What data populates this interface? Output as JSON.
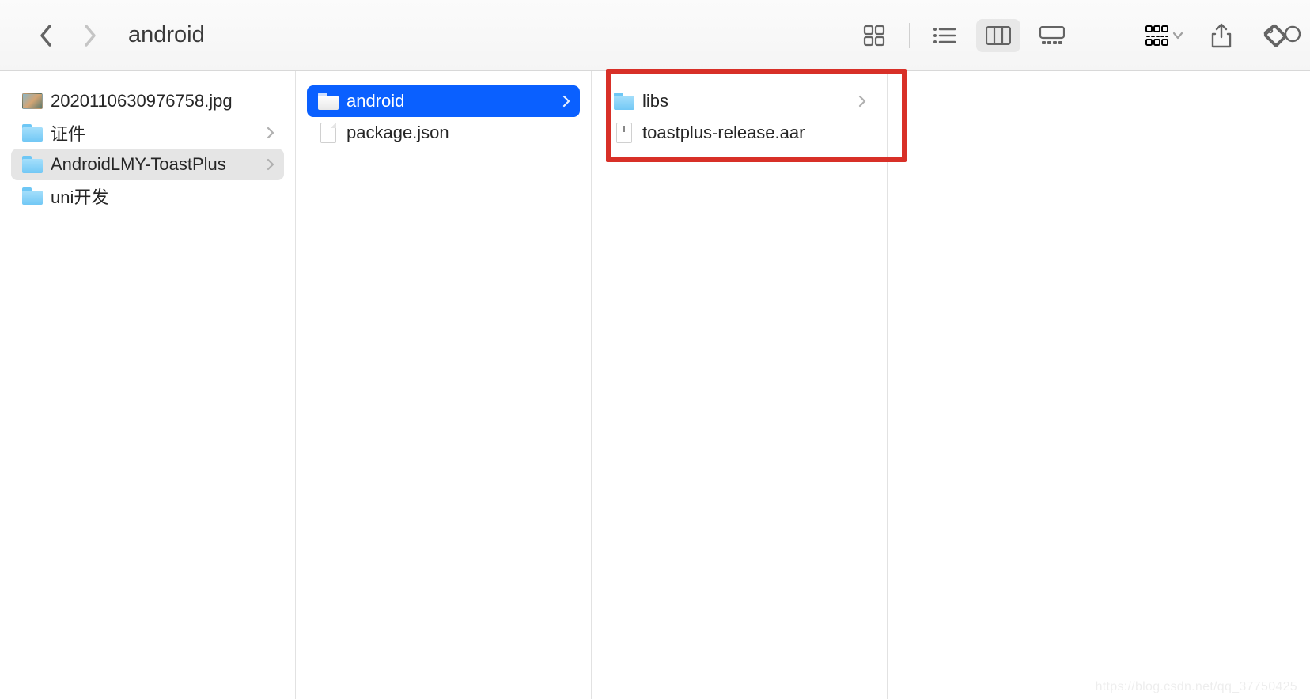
{
  "toolbar": {
    "title": "android"
  },
  "columns": [
    {
      "items": [
        {
          "type": "image",
          "label": "2020110630976758.jpg",
          "hasChevron": false
        },
        {
          "type": "folder",
          "label": "证件",
          "hasChevron": true
        },
        {
          "type": "folder",
          "label": "AndroidLMY-ToastPlus",
          "hasChevron": true,
          "selected": "gray"
        },
        {
          "type": "folder",
          "label": "uni开发",
          "hasChevron": false
        }
      ]
    },
    {
      "items": [
        {
          "type": "folder",
          "label": "android",
          "hasChevron": true,
          "selected": "blue"
        },
        {
          "type": "doc",
          "label": "package.json",
          "hasChevron": false
        }
      ]
    },
    {
      "items": [
        {
          "type": "folder",
          "label": "libs",
          "hasChevron": true
        },
        {
          "type": "aar",
          "label": "toastplus-release.aar",
          "hasChevron": false
        }
      ]
    }
  ],
  "watermark": "https://blog.csdn.net/qq_37750425"
}
